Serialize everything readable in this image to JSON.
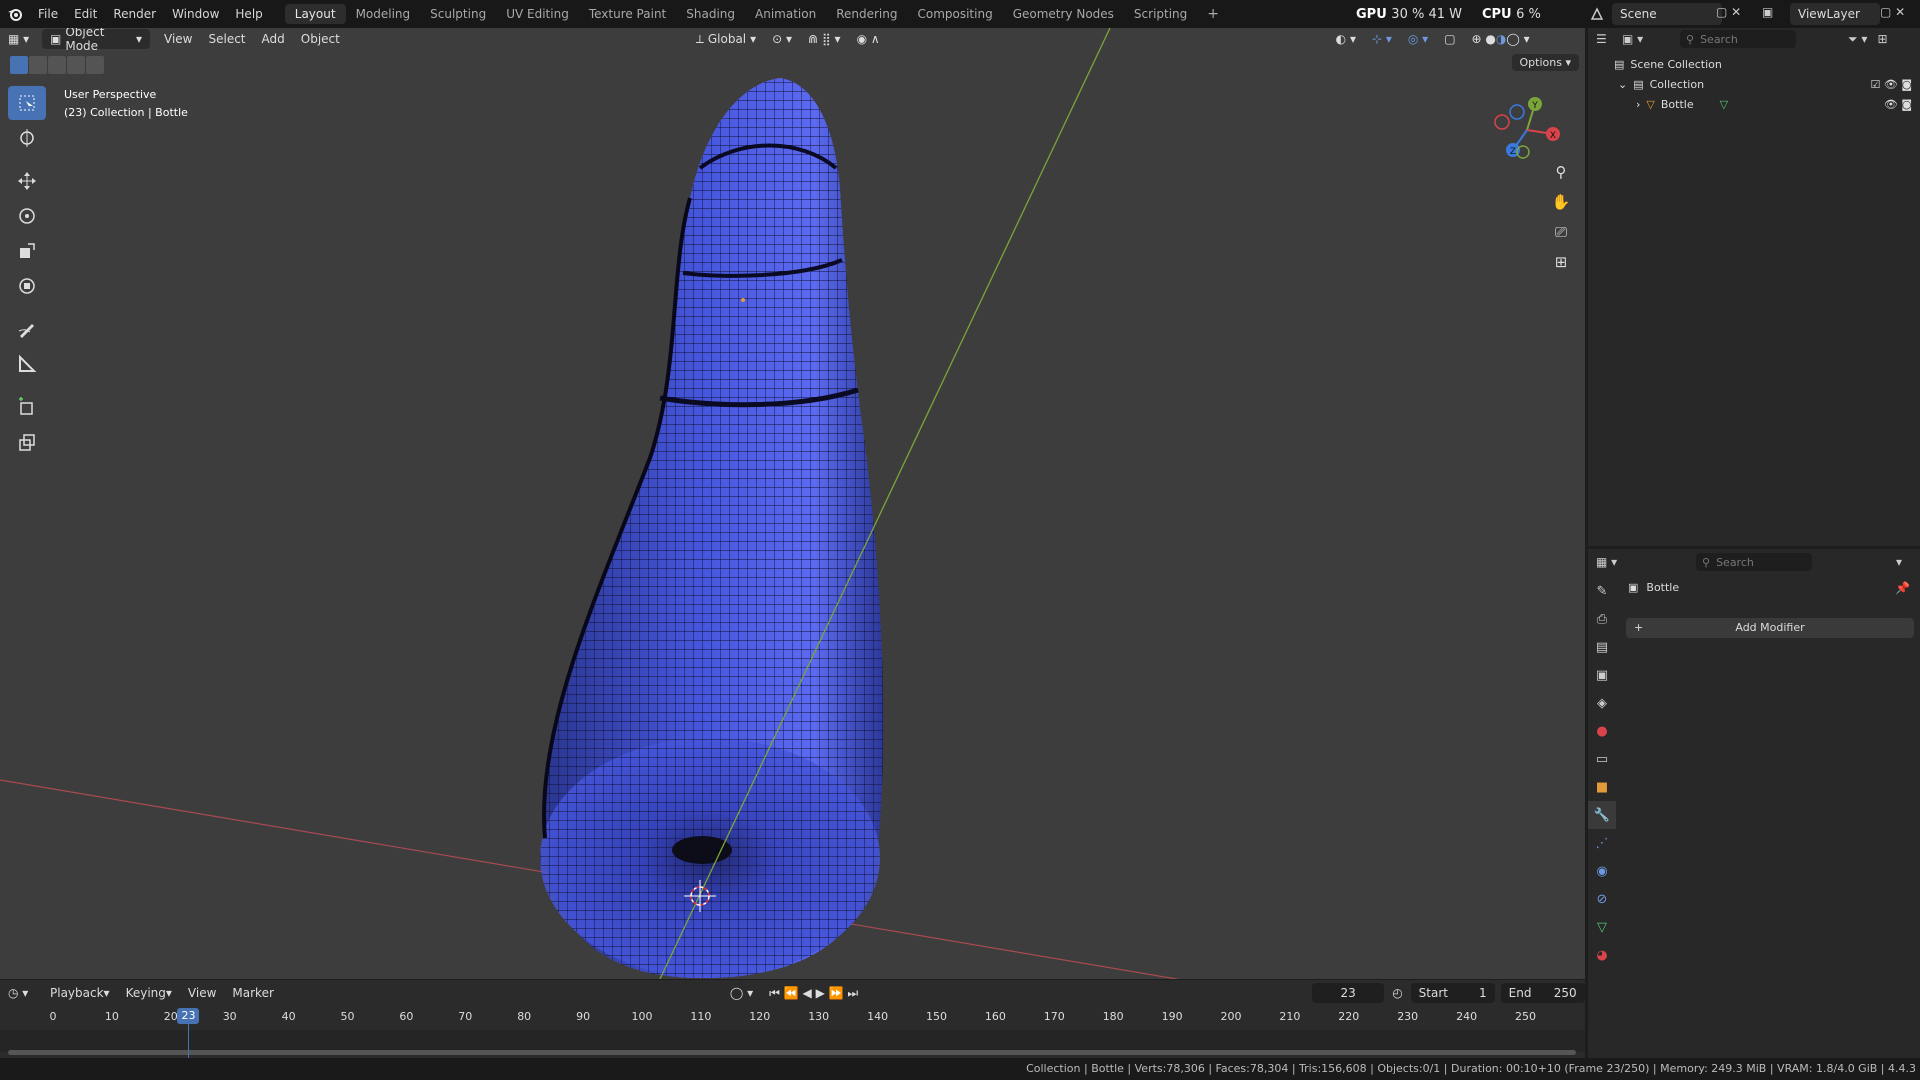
{
  "topbar": {
    "menus": [
      "File",
      "Edit",
      "Render",
      "Window",
      "Help"
    ],
    "workspaces": [
      "Layout",
      "Modeling",
      "Sculpting",
      "UV Editing",
      "Texture Paint",
      "Shading",
      "Animation",
      "Rendering",
      "Compositing",
      "Geometry Nodes",
      "Scripting"
    ],
    "active_workspace": "Layout",
    "add_workspace": "+",
    "gpu_label": "GPU",
    "gpu_value": "30 % 41 W",
    "cpu_label": "CPU",
    "cpu_value": "6 %",
    "scene": "Scene",
    "view_layer": "ViewLayer"
  },
  "viewport": {
    "mode": "Object Mode",
    "menus": [
      "View",
      "Select",
      "Add",
      "Object"
    ],
    "orientation": "Global",
    "options": "Options",
    "info_line1": "User Perspective",
    "info_line2": "(23) Collection | Bottle",
    "toolbar_tools": [
      "select-box-icon",
      "cursor-icon",
      "move-icon",
      "rotate-icon",
      "scale-icon",
      "transform-icon",
      "annotate-icon",
      "measure-icon",
      "add-cube-icon",
      "extrude-icon"
    ],
    "gizmo_axis_labels": [
      "Y",
      "X",
      "Z"
    ],
    "mesh_color": "#3d4fd6"
  },
  "timeline": {
    "menus": [
      "Playback",
      "Keying",
      "View",
      "Marker"
    ],
    "current_frame": "23",
    "start_label": "Start",
    "start_value": "1",
    "end_label": "End",
    "end_value": "250",
    "ticks": [
      "0",
      "10",
      "20",
      "30",
      "40",
      "50",
      "60",
      "70",
      "80",
      "90",
      "100",
      "110",
      "120",
      "130",
      "140",
      "150",
      "160",
      "170",
      "180",
      "190",
      "200",
      "210",
      "220",
      "230",
      "240",
      "250"
    ],
    "playhead_value": 23
  },
  "outliner": {
    "search_placeholder": "Search",
    "scene_collection": "Scene Collection",
    "collection": "Collection",
    "object": "Bottle"
  },
  "properties": {
    "search_placeholder": "Search",
    "object_name": "Bottle",
    "add_modifier": "Add Modifier",
    "tab_icons": [
      "tool-icon",
      "render-icon",
      "output-icon",
      "view-layer-icon",
      "scene-icon",
      "world-icon",
      "collection-icon",
      "object-icon",
      "modifier-icon",
      "particles-icon",
      "physics-icon",
      "constraints-icon",
      "data-icon",
      "material-icon"
    ]
  },
  "statusbar": {
    "text": "Collection | Bottle | Verts:78,306 | Faces:78,304 | Tris:156,608 | Objects:0/1 | Duration: 00:10+10 (Frame 23/250) | Memory: 249.3 MiB | VRAM: 1.8/4.0 GiB | 4.4.3"
  }
}
